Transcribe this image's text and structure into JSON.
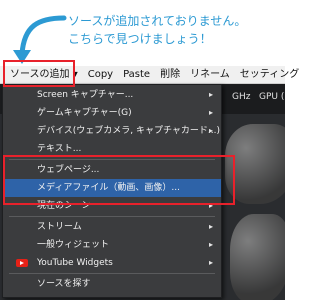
{
  "tip": {
    "text": "ソースが追加されておりません。\nこちらで見つけましょう！",
    "color": "#2c9ad3"
  },
  "toolbar": {
    "add_source": "ソースの追加",
    "add_source_arrow": "▾",
    "copy": "Copy",
    "paste": "Paste",
    "delete": "削除",
    "rename": "リネーム",
    "settings": "セッティング"
  },
  "preview": {
    "stats": [
      "GHz",
      "GPU ("
    ]
  },
  "menu": {
    "items": [
      {
        "label": "Screen キャプチャー...",
        "submenu": true
      },
      {
        "label": "ゲームキャプチャー(G)",
        "submenu": true
      },
      {
        "label": "デバイス(ウェブカメラ, キャプチャカード...)",
        "submenu": true
      },
      {
        "label": "テキスト...",
        "submenu": false
      },
      {
        "label": "ウェブページ...",
        "submenu": false
      },
      {
        "label": "メディアファイル（動画、画像）...",
        "submenu": false,
        "highlighted": true
      },
      {
        "label": "現在のシーン",
        "submenu": true
      },
      {
        "label": "ストリーム",
        "submenu": true
      },
      {
        "label": "一般ウィジェット",
        "submenu": true
      },
      {
        "label": "YouTube Widgets",
        "submenu": true,
        "icon": "youtube-icon"
      },
      {
        "label": "ソースを探す",
        "submenu": false
      }
    ],
    "submenu_glyph": "▸",
    "highlight_color": "#2e63a8"
  },
  "annotation_color": "#e8212b"
}
